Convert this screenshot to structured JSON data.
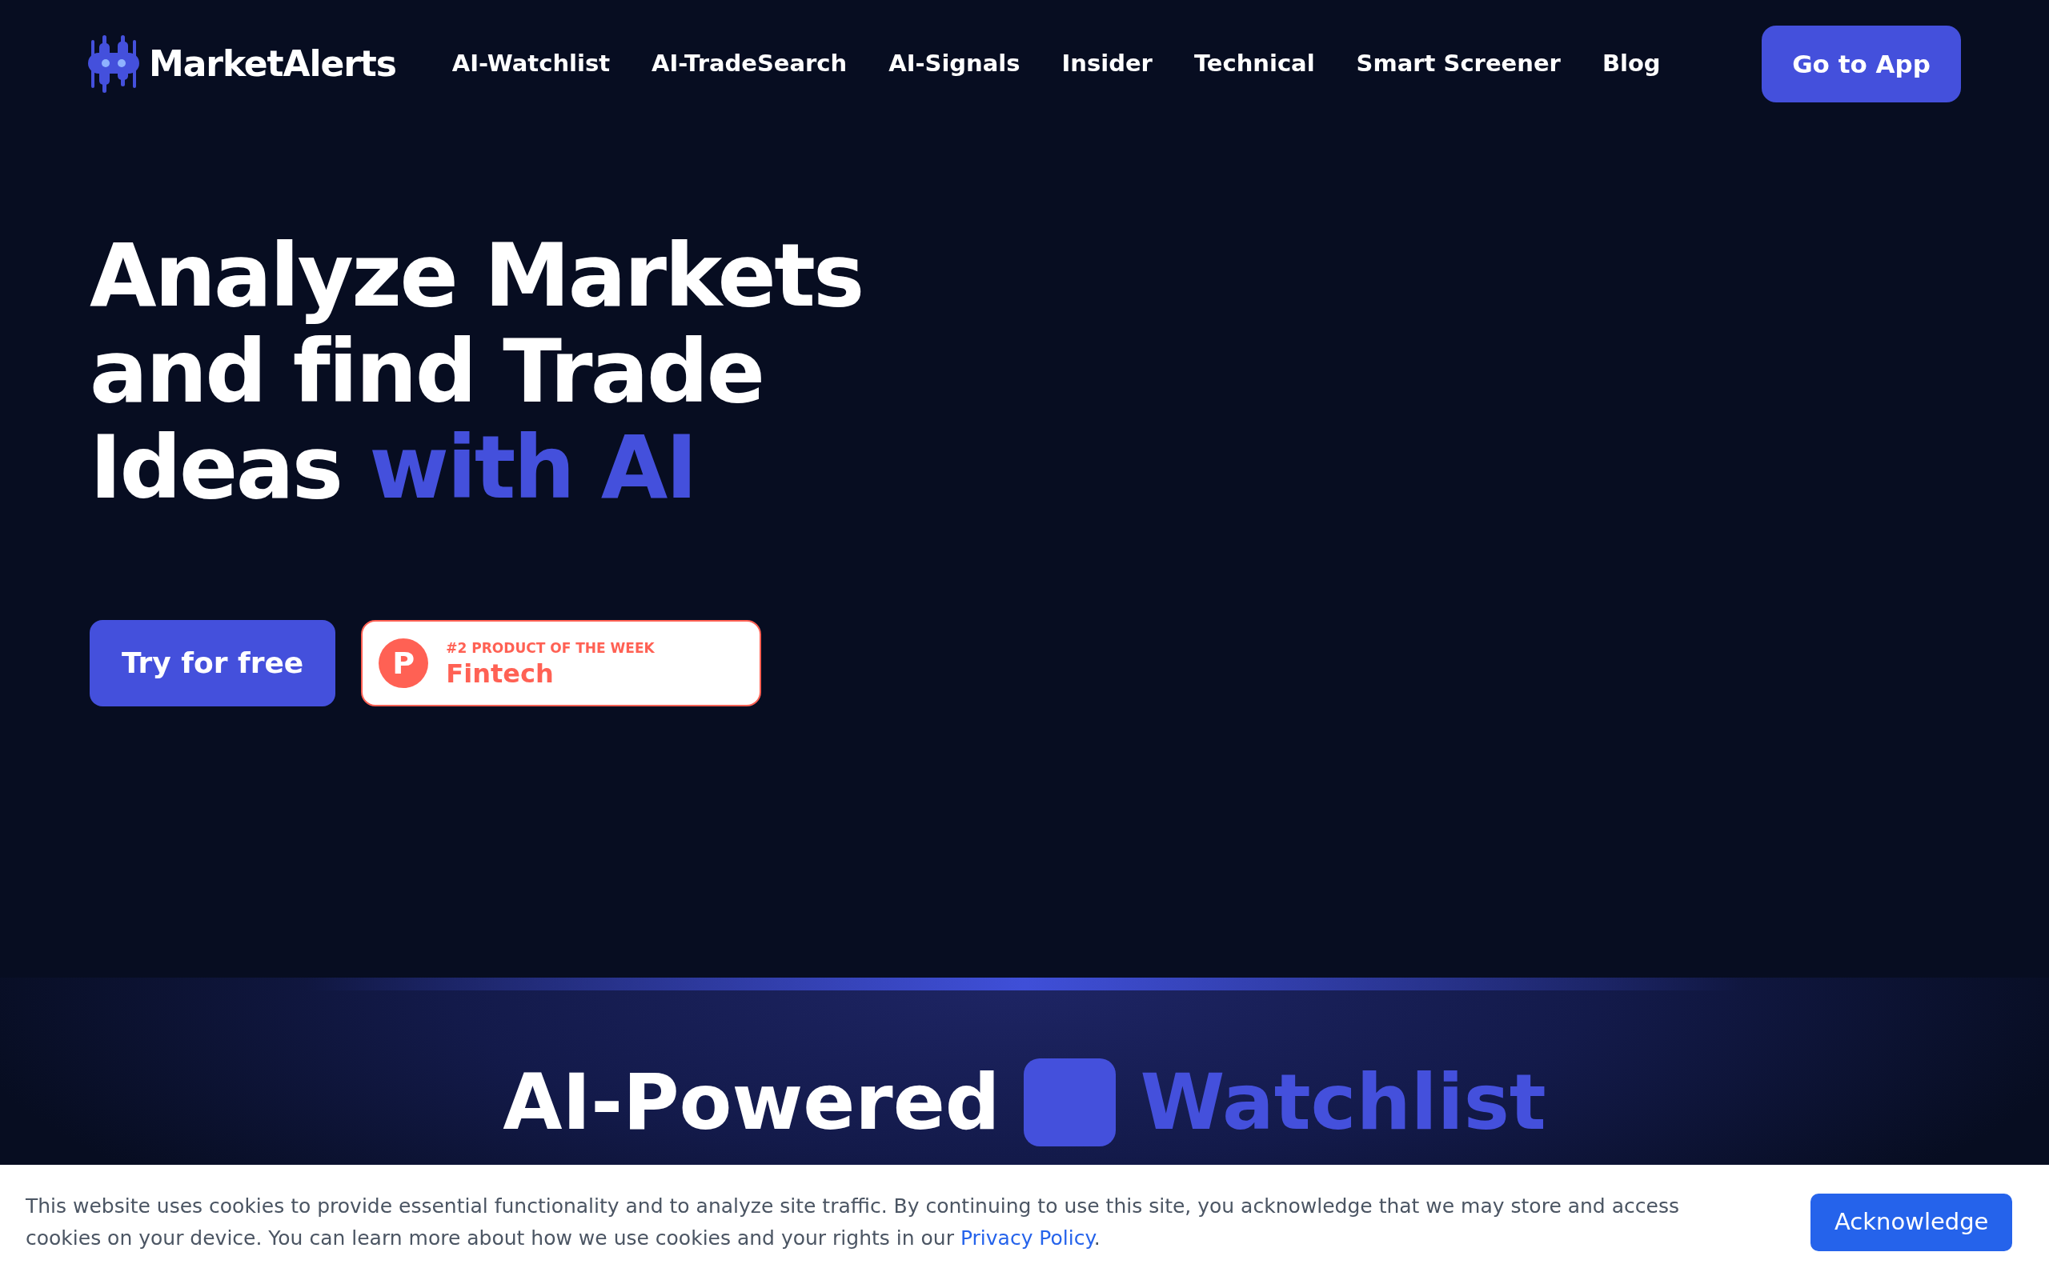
{
  "header": {
    "brand": "MarketAlerts",
    "nav": [
      "AI-Watchlist",
      "AI-TradeSearch",
      "AI-Signals",
      "Insider",
      "Technical",
      "Smart Screener",
      "Blog"
    ],
    "cta": "Go to App"
  },
  "hero": {
    "title": "Analyze Markets and find Trade Ideas **with AI**",
    "primary_button": "Try for free",
    "badge": {
      "letter": "P",
      "caption": "#2 PRODUCT OF THE WEEK",
      "category": "Fintech"
    }
  },
  "section": {
    "title_start": "AI-Powered",
    "title_end": "Watchlist"
  },
  "cookie_banner": {
    "text": "This website uses cookies to provide essential functionality and to analyze site traffic. By continuing to use this site, you acknowledge that we may store and access cookies on your device. You can learn more about how we use cookies and your rights in our",
    "link": "Privacy Policy",
    "end": ".",
    "button": "Acknowledge"
  }
}
